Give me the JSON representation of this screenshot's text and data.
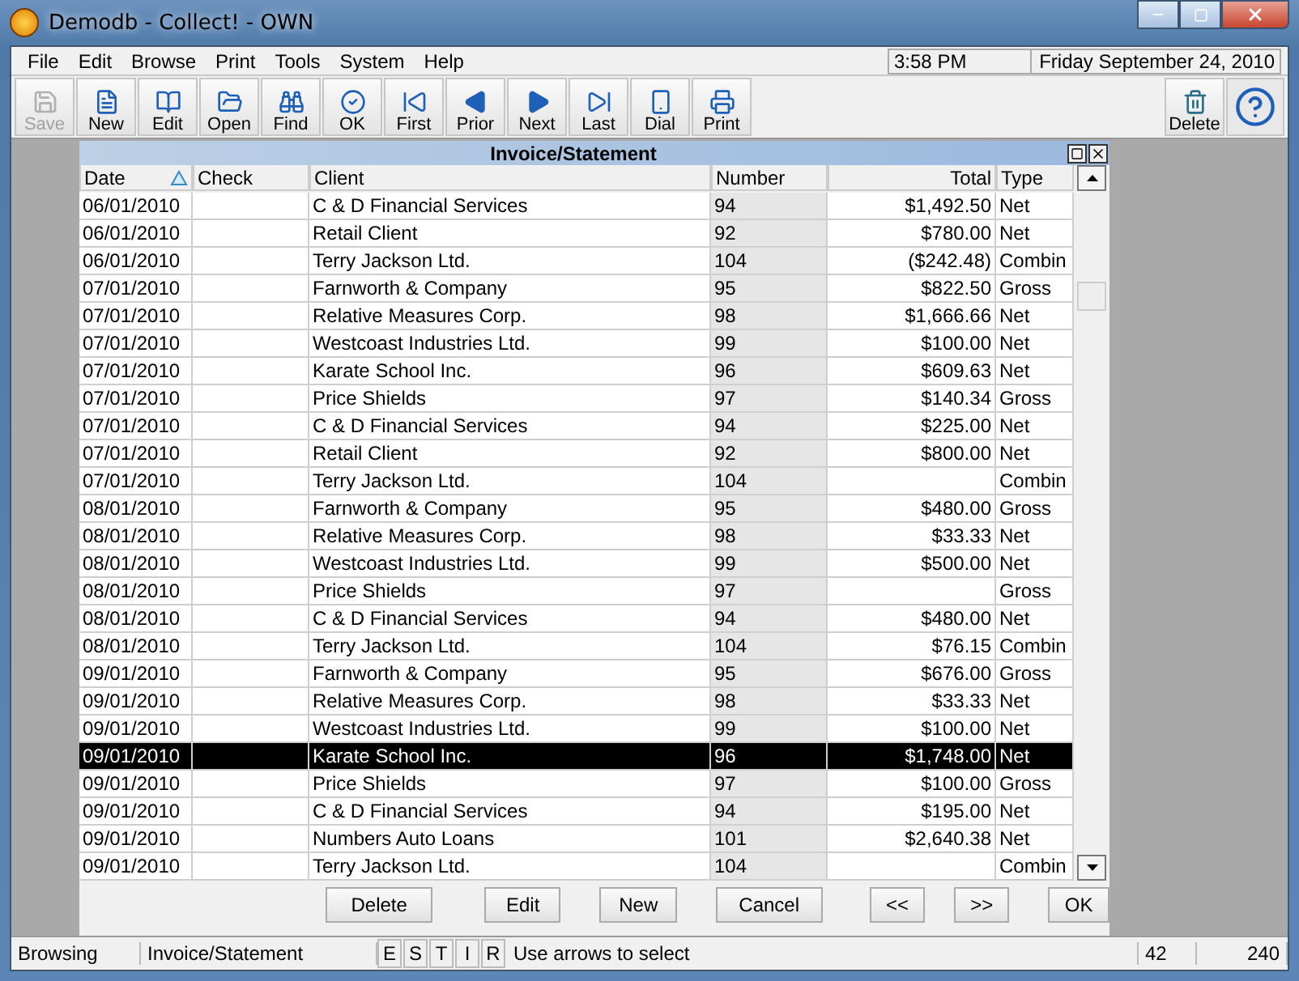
{
  "window": {
    "title": "Demodb - Collect! - OWN"
  },
  "menu": [
    "File",
    "Edit",
    "Browse",
    "Print",
    "Tools",
    "System",
    "Help"
  ],
  "clock": {
    "time": "3:58 PM",
    "date": "Friday  September 24, 2010"
  },
  "toolbar": [
    {
      "label": "Save",
      "disabled": true
    },
    {
      "label": "New",
      "disabled": false
    },
    {
      "label": "Edit",
      "disabled": false
    },
    {
      "label": "Open",
      "disabled": false
    },
    {
      "label": "Find",
      "disabled": false
    },
    {
      "label": "OK",
      "disabled": false
    },
    {
      "label": "First",
      "disabled": false
    },
    {
      "label": "Prior",
      "disabled": false
    },
    {
      "label": "Next",
      "disabled": false
    },
    {
      "label": "Last",
      "disabled": false
    },
    {
      "label": "Dial",
      "disabled": false
    },
    {
      "label": "Print",
      "disabled": false
    }
  ],
  "toolbar_right": {
    "label": "Delete"
  },
  "panel": {
    "title": "Invoice/Statement",
    "columns": [
      "Date",
      "Check",
      "Client",
      "Number",
      "Total",
      "Type"
    ],
    "rows": [
      {
        "cells": [
          "06/01/2010",
          "",
          "C & D Financial Services",
          "94",
          "$1,492.50",
          "Net"
        ],
        "selected": false
      },
      {
        "cells": [
          "06/01/2010",
          "",
          "Retail Client",
          "92",
          "$780.00",
          "Net"
        ],
        "selected": false
      },
      {
        "cells": [
          "06/01/2010",
          "",
          "Terry Jackson Ltd.",
          "104",
          "($242.48)",
          "Combin"
        ],
        "selected": false
      },
      {
        "cells": [
          "07/01/2010",
          "",
          "Farnworth & Company",
          "95",
          "$822.50",
          "Gross"
        ],
        "selected": false
      },
      {
        "cells": [
          "07/01/2010",
          "",
          "Relative Measures Corp.",
          "98",
          "$1,666.66",
          "Net"
        ],
        "selected": false
      },
      {
        "cells": [
          "07/01/2010",
          "",
          "Westcoast Industries Ltd.",
          "99",
          "$100.00",
          "Net"
        ],
        "selected": false
      },
      {
        "cells": [
          "07/01/2010",
          "",
          "Karate School Inc.",
          "96",
          "$609.63",
          "Net"
        ],
        "selected": false
      },
      {
        "cells": [
          "07/01/2010",
          "",
          "Price Shields",
          "97",
          "$140.34",
          "Gross"
        ],
        "selected": false
      },
      {
        "cells": [
          "07/01/2010",
          "",
          "C & D Financial Services",
          "94",
          "$225.00",
          "Net"
        ],
        "selected": false
      },
      {
        "cells": [
          "07/01/2010",
          "",
          "Retail Client",
          "92",
          "$800.00",
          "Net"
        ],
        "selected": false
      },
      {
        "cells": [
          "07/01/2010",
          "",
          "Terry Jackson Ltd.",
          "104",
          "",
          "Combin"
        ],
        "selected": false
      },
      {
        "cells": [
          "08/01/2010",
          "",
          "Farnworth & Company",
          "95",
          "$480.00",
          "Gross"
        ],
        "selected": false
      },
      {
        "cells": [
          "08/01/2010",
          "",
          "Relative Measures Corp.",
          "98",
          "$33.33",
          "Net"
        ],
        "selected": false
      },
      {
        "cells": [
          "08/01/2010",
          "",
          "Westcoast Industries Ltd.",
          "99",
          "$500.00",
          "Net"
        ],
        "selected": false
      },
      {
        "cells": [
          "08/01/2010",
          "",
          "Price Shields",
          "97",
          "",
          "Gross"
        ],
        "selected": false
      },
      {
        "cells": [
          "08/01/2010",
          "",
          "C & D Financial Services",
          "94",
          "$480.00",
          "Net"
        ],
        "selected": false
      },
      {
        "cells": [
          "08/01/2010",
          "",
          "Terry Jackson Ltd.",
          "104",
          "$76.15",
          "Combin"
        ],
        "selected": false
      },
      {
        "cells": [
          "09/01/2010",
          "",
          "Farnworth & Company",
          "95",
          "$676.00",
          "Gross"
        ],
        "selected": false
      },
      {
        "cells": [
          "09/01/2010",
          "",
          "Relative Measures Corp.",
          "98",
          "$33.33",
          "Net"
        ],
        "selected": false
      },
      {
        "cells": [
          "09/01/2010",
          "",
          "Westcoast Industries Ltd.",
          "99",
          "$100.00",
          "Net"
        ],
        "selected": false
      },
      {
        "cells": [
          "09/01/2010",
          "",
          "Karate School Inc.",
          "96",
          "$1,748.00",
          "Net"
        ],
        "selected": true
      },
      {
        "cells": [
          "09/01/2010",
          "",
          "Price Shields",
          "97",
          "$100.00",
          "Gross"
        ],
        "selected": false
      },
      {
        "cells": [
          "09/01/2010",
          "",
          "C & D Financial Services",
          "94",
          "$195.00",
          "Net"
        ],
        "selected": false
      },
      {
        "cells": [
          "09/01/2010",
          "",
          "Numbers Auto Loans",
          "101",
          "$2,640.38",
          "Net"
        ],
        "selected": false
      },
      {
        "cells": [
          "09/01/2010",
          "",
          "Terry Jackson Ltd.",
          "104",
          "",
          "Combin"
        ],
        "selected": false
      }
    ],
    "buttons": [
      "Delete",
      "Edit",
      "New",
      "Cancel",
      "<<",
      ">>",
      "OK"
    ]
  },
  "status_bar": {
    "mode": "Browsing",
    "form": "Invoice/Statement",
    "flags": [
      "E",
      "S",
      "T",
      "I",
      "R"
    ],
    "hint": "Use arrows to select",
    "count": "42",
    "total": "240"
  }
}
